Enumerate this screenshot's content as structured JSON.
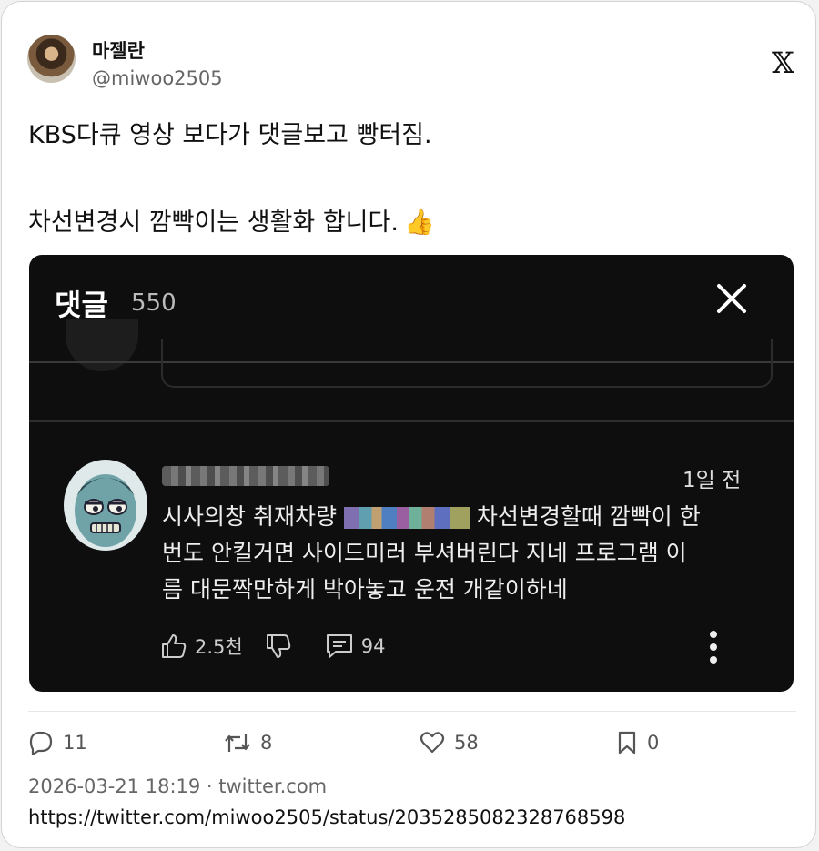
{
  "user": {
    "display_name": "마젤란",
    "handle": "@miwoo2505"
  },
  "tweet": {
    "line1": "KBS다큐 영상 보다가 댓글보고 빵터짐.",
    "line2": "차선변경시 깜빡이는 생활화 합니다.",
    "emoji": "👍"
  },
  "comment_screen": {
    "title": "댓글",
    "count": "550",
    "comment": {
      "time": "1일 전",
      "text_part1": "시사의창 취재차량 ",
      "text_part2": " 차선변경할때 깜빡이 한\n번도 안킬거면 사이드미러 부셔버린다 지네 프로그램 이\n름 대문짝만하게 박아놓고 운전 개같이하네",
      "likes": "2.5천",
      "replies": "94"
    }
  },
  "stats": {
    "replies": "11",
    "retweets": "8",
    "likes": "58",
    "bookmarks": "0"
  },
  "meta": {
    "timestamp_source": "2026-03-21 18:19 · twitter.com"
  },
  "url": "https://twitter.com/miwoo2505/status/2035285082328768598"
}
